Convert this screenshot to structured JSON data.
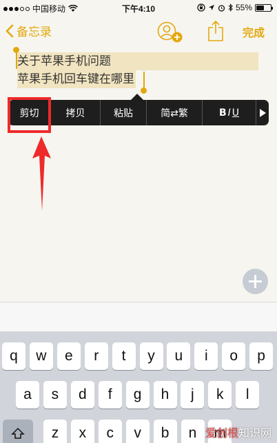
{
  "status_bar": {
    "carrier": "中国移动",
    "time": "下午4:10",
    "battery": "55%",
    "battery_level": 0.55
  },
  "nav": {
    "back_label": "备忘录",
    "done_label": "完成",
    "icons": [
      "back-chevron-icon",
      "add-person-icon",
      "share-icon"
    ]
  },
  "note": {
    "line1": "关于苹果手机问题",
    "line2": "苹果手机回车键在哪里"
  },
  "edit_menu": {
    "cut": "剪切",
    "copy": "拷贝",
    "paste": "粘贴",
    "convert": "简⇄繁",
    "bold": "B",
    "italic": "I",
    "underline": "U"
  },
  "keyboard": {
    "row1": [
      "q",
      "w",
      "e",
      "r",
      "t",
      "y",
      "u",
      "i",
      "o",
      "p"
    ],
    "row2": [
      "a",
      "s",
      "d",
      "f",
      "g",
      "h",
      "j",
      "k",
      "l"
    ],
    "row3": [
      "z",
      "x",
      "c",
      "v",
      "b",
      "n",
      "m"
    ]
  },
  "watermark": {
    "accent": "爱创根",
    "rest": "知识网"
  },
  "colors": {
    "accent": "#e3a80d",
    "highlight": "#f1e4c0",
    "annotation": "#ee2a2a",
    "menu_bg": "#1e1e1e"
  }
}
